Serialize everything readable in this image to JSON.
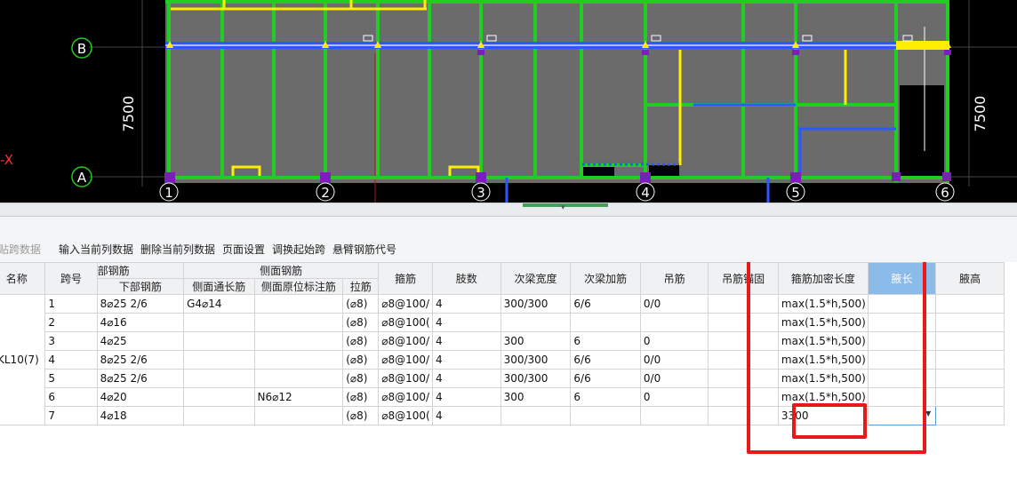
{
  "cad": {
    "axis_row_labels": [
      "B",
      "A"
    ],
    "axis_col_labels": [
      "1",
      "2",
      "3",
      "4",
      "5",
      "6"
    ],
    "dimension_left": "7500",
    "dimension_right": "7500",
    "partial_axis_label": "-X",
    "colors": {
      "background": "#000000",
      "slab": "#6b6b6b",
      "beam": "#22cc22",
      "selected_beam": "#2f57ff",
      "highlight": "#ffee00",
      "column": "#7a1fb8"
    }
  },
  "toolbar": {
    "paste_span": "粘贴跨数据",
    "input_column": "输入当前列数据",
    "delete_column": "删除当前列数据",
    "page_settings": "页面设置",
    "swap_start_span": "调换起始跨",
    "cantilever_code": "悬臂钢筋代号"
  },
  "table": {
    "headers": {
      "name": "名称",
      "span_no": "跨号",
      "bottom_group": "部钢筋",
      "bottom_rebar": "下部钢筋",
      "side_group": "侧面钢筋",
      "side_through": "侧面通长筋",
      "side_in_situ": "侧面原位标注筋",
      "tie_bar": "拉筋",
      "stirrup": "箍筋",
      "legs": "肢数",
      "sec_beam_width": "次梁宽度",
      "sec_beam_add": "次梁加筋",
      "hanger": "吊筋",
      "hanger_anchor": "吊筋锚固",
      "stirrup_dense_len": "箍筋加密长度",
      "haunch_len": "腋长",
      "haunch_height": "腋高"
    },
    "beam_name": "KL10(7)",
    "rows": [
      {
        "span": "1",
        "bottom": "8⌀25 2/6",
        "side_through": "G4⌀14",
        "side_in_situ": "",
        "tie": "(⌀8)",
        "stirrup": "⌀8@100/",
        "legs": "4",
        "sec_width": "300/300",
        "sec_add": "6/6",
        "hanger": "0/0",
        "anchor": "",
        "dense": "max(1.5*h,500)",
        "haunch": ""
      },
      {
        "span": "2",
        "bottom": "4⌀16",
        "side_through": "",
        "side_in_situ": "",
        "tie": "(⌀8)",
        "stirrup": "⌀8@100(",
        "legs": "4",
        "sec_width": "",
        "sec_add": "",
        "hanger": "",
        "anchor": "",
        "dense": "max(1.5*h,500)",
        "haunch": ""
      },
      {
        "span": "3",
        "bottom": "4⌀25",
        "side_through": "",
        "side_in_situ": "",
        "tie": "(⌀8)",
        "stirrup": "⌀8@100/",
        "legs": "4",
        "sec_width": "300",
        "sec_add": "6",
        "hanger": "0",
        "anchor": "",
        "dense": "max(1.5*h,500)",
        "haunch": ""
      },
      {
        "span": "4",
        "bottom": "8⌀25 2/6",
        "side_through": "",
        "side_in_situ": "",
        "tie": "(⌀8)",
        "stirrup": "⌀8@100/",
        "legs": "4",
        "sec_width": "300/300",
        "sec_add": "6/6",
        "hanger": "0/0",
        "anchor": "",
        "dense": "max(1.5*h,500)",
        "haunch": ""
      },
      {
        "span": "5",
        "bottom": "8⌀25 2/6",
        "side_through": "",
        "side_in_situ": "",
        "tie": "(⌀8)",
        "stirrup": "⌀8@100/",
        "legs": "4",
        "sec_width": "300/300",
        "sec_add": "6/6",
        "hanger": "0/0",
        "anchor": "",
        "dense": "max(1.5*h,500)",
        "haunch": ""
      },
      {
        "span": "6",
        "bottom": "4⌀20",
        "side_through": "",
        "side_in_situ": "N6⌀12",
        "tie": "(⌀8)",
        "stirrup": "⌀8@100/",
        "legs": "4",
        "sec_width": "300",
        "sec_add": "6",
        "hanger": "0",
        "anchor": "",
        "dense": "max(1.5*h,500)",
        "haunch": ""
      },
      {
        "span": "7",
        "bottom": "4⌀18",
        "side_through": "",
        "side_in_situ": "",
        "tie": "(⌀8)",
        "stirrup": "⌀8@100(",
        "legs": "4",
        "sec_width": "",
        "sec_add": "",
        "hanger": "",
        "anchor": "",
        "dense": "3300",
        "haunch": ""
      }
    ]
  },
  "annotation_color": "#e8191b"
}
